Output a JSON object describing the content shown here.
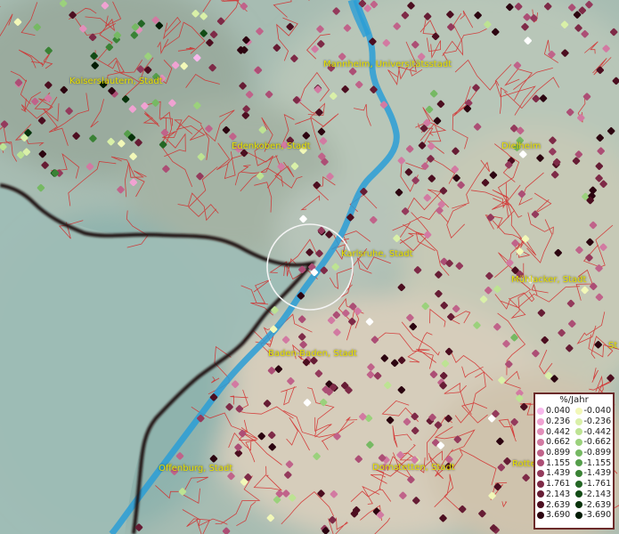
{
  "map": {
    "cities": [
      {
        "id": "kaiserslautern",
        "name": "Kaiserslautern, Stadt"
      },
      {
        "id": "mannheim",
        "name": "Mannheim, Universitätsstadt"
      },
      {
        "id": "edenkoben",
        "name": "Edenkoben, Stadt"
      },
      {
        "id": "dielheim",
        "name": "Dielheim"
      },
      {
        "id": "karlsruhe",
        "name": "Karlsruhe, Stadt"
      },
      {
        "id": "muehlacker",
        "name": "Mühlacker, Stadt"
      },
      {
        "id": "baden-baden",
        "name": "Baden-Baden, Stadt"
      },
      {
        "id": "offenburg",
        "name": "Offenburg, Stadt"
      },
      {
        "id": "dornstetten",
        "name": "Dornstetten, Stadt"
      },
      {
        "id": "partial-right-1",
        "name": "St"
      },
      {
        "id": "partial-right-2",
        "name": "Rotte"
      }
    ],
    "legend": {
      "title": "%/Jahr",
      "positive": [
        {
          "label": "0.040",
          "color": "#f7b8ec"
        },
        {
          "label": "0.236",
          "color": "#f0a2d2"
        },
        {
          "label": "0.442",
          "color": "#e28fba"
        },
        {
          "label": "0.662",
          "color": "#d27aa2"
        },
        {
          "label": "0.899",
          "color": "#c0638a"
        },
        {
          "label": "1.155",
          "color": "#ac4e75"
        },
        {
          "label": "1.439",
          "color": "#943a5c"
        },
        {
          "label": "1.761",
          "color": "#7e2a47"
        },
        {
          "label": "2.143",
          "color": "#661c34"
        },
        {
          "label": "2.639",
          "color": "#4c0e20"
        },
        {
          "label": "3.690",
          "color": "#2c0410"
        }
      ],
      "negative": [
        {
          "label": "-0.040",
          "color": "#f2f8b8"
        },
        {
          "label": "-0.236",
          "color": "#d9f0a8"
        },
        {
          "label": "-0.442",
          "color": "#bde393"
        },
        {
          "label": "-0.662",
          "color": "#9bd17c"
        },
        {
          "label": "-0.899",
          "color": "#76b963"
        },
        {
          "label": "-1.155",
          "color": "#559e4b"
        },
        {
          "label": "-1.439",
          "color": "#3a8235"
        },
        {
          "label": "-1.761",
          "color": "#236624"
        },
        {
          "label": "-2.143",
          "color": "#124b15"
        },
        {
          "label": "-2.639",
          "color": "#08330b"
        },
        {
          "label": "-3.690",
          "color": "#021c04"
        }
      ]
    },
    "colors": {
      "river": "#2a9ed6",
      "boundary": "#d42a2a",
      "border": "#1b1010",
      "lowland": "#8fb4ad",
      "highland": "#c9c2a8"
    }
  }
}
